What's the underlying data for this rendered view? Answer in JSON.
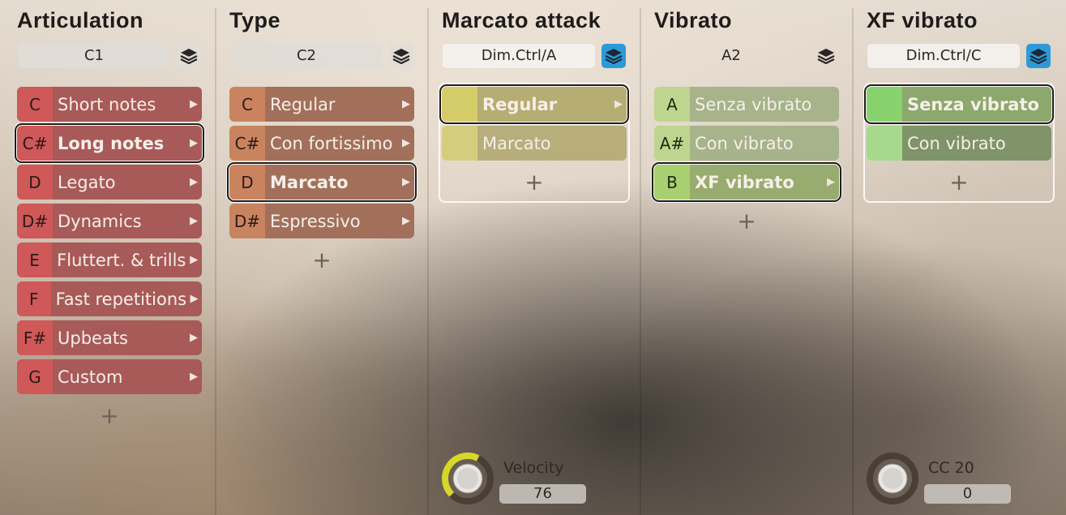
{
  "columns": [
    {
      "title": "Articulation",
      "selector": "C1",
      "items": [
        {
          "key": "C",
          "label": "Short notes"
        },
        {
          "key": "C#",
          "label": "Long notes",
          "selected": true
        },
        {
          "key": "D",
          "label": "Legato"
        },
        {
          "key": "D#",
          "label": "Dynamics"
        },
        {
          "key": "E",
          "label": "Fluttert. & trills"
        },
        {
          "key": "F",
          "label": "Fast repetitions"
        },
        {
          "key": "F#",
          "label": "Upbeats"
        },
        {
          "key": "G",
          "label": "Custom"
        }
      ],
      "add_label": "+"
    },
    {
      "title": "Type",
      "selector": "C2",
      "items": [
        {
          "key": "C",
          "label": "Regular"
        },
        {
          "key": "C#",
          "label": "Con fortissimo"
        },
        {
          "key": "D",
          "label": "Marcato",
          "selected": true
        },
        {
          "key": "D#",
          "label": "Espressivo"
        }
      ],
      "add_label": "+"
    },
    {
      "title": "Marcato attack",
      "selector": "Dim.Ctrl/A",
      "items": [
        {
          "key": "",
          "label": "Regular",
          "selected": true
        },
        {
          "key": "",
          "label": "Marcato"
        }
      ],
      "add_label": "+",
      "knob": {
        "label": "Velocity",
        "value": "76",
        "level": 0.6
      }
    },
    {
      "title": "Vibrato",
      "selector": "A2",
      "items": [
        {
          "key": "A",
          "label": "Senza vibrato"
        },
        {
          "key": "A#",
          "label": "Con vibrato"
        },
        {
          "key": "B",
          "label": "XF vibrato",
          "selected": true
        }
      ],
      "add_label": "+"
    },
    {
      "title": "XF vibrato",
      "selector": "Dim.Ctrl/C",
      "items": [
        {
          "key": "",
          "label": "Senza vibrato",
          "selected": true
        },
        {
          "key": "",
          "label": "Con vibrato"
        }
      ],
      "add_label": "+",
      "knob": {
        "label": "CC 20",
        "value": "0",
        "level": 0
      }
    }
  ],
  "colors": {
    "articulation": "#cf5858",
    "type": "#c9845f",
    "marcato_attack": "#d4cc69",
    "vibrato": "#bed58f",
    "xf_vibrato": "#88d26e",
    "active_button": "#2d9ad8",
    "knob_arc": "#d7d62a"
  },
  "icons": {
    "layer_button": "layers-icon",
    "item_arrow": "chevron-right-icon",
    "add": "plus-icon"
  }
}
